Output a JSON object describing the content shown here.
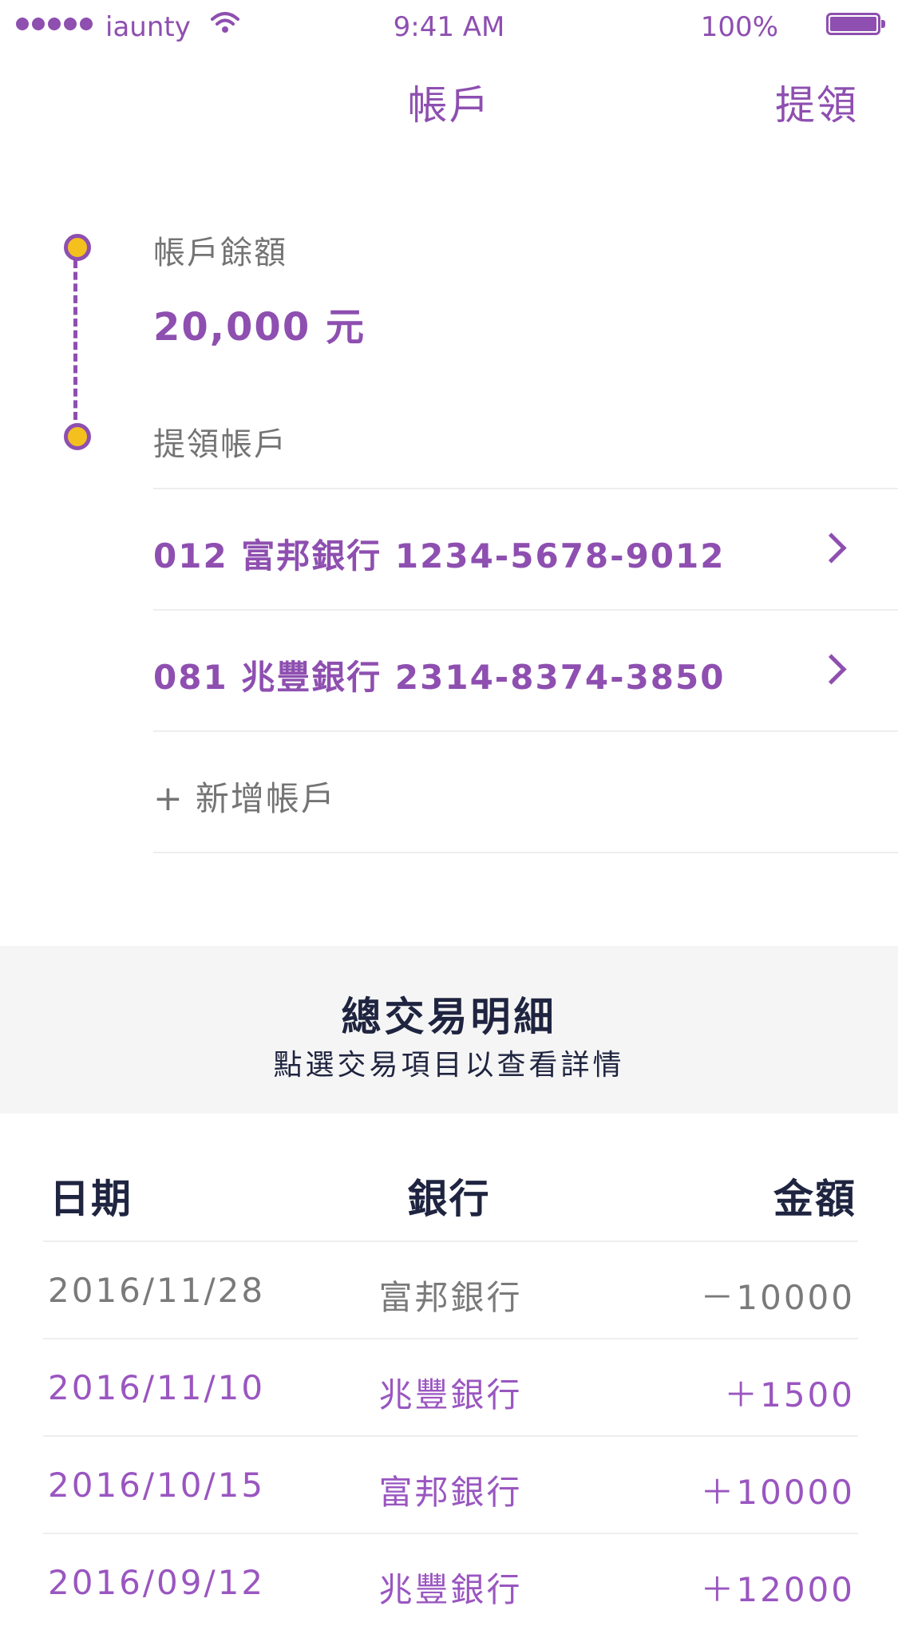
{
  "status_bar": {
    "carrier": "iaunty",
    "time": "9:41 AM",
    "battery": "100%"
  },
  "nav": {
    "title": "帳戶",
    "right_action": "提領"
  },
  "balance": {
    "label": "帳戶餘額",
    "value": "20,000 元"
  },
  "withdraw": {
    "label": "提領帳戶",
    "accounts": [
      {
        "label": "012 富邦銀行 1234-5678-9012"
      },
      {
        "label": "081 兆豐銀行 2314-8374-3850"
      }
    ],
    "add_label": "新增帳戶"
  },
  "summary": {
    "title": "總交易明細",
    "subtitle": "點選交易項目以查看詳情"
  },
  "table": {
    "headers": {
      "date": "日期",
      "bank": "銀行",
      "amount": "金額"
    },
    "rows": [
      {
        "date": "2016/11/28",
        "bank": "富邦銀行",
        "amount": "－10000"
      },
      {
        "date": "2016/11/10",
        "bank": "兆豐銀行",
        "amount": "＋1500"
      },
      {
        "date": "2016/10/15",
        "bank": "富邦銀行",
        "amount": "＋10000"
      },
      {
        "date": "2016/09/12",
        "bank": "兆豐銀行",
        "amount": "＋12000"
      }
    ]
  },
  "colors": {
    "accent": "#8e4fb0",
    "dot": "#f4c01e",
    "dark_text": "#1f2440",
    "gray_text": "#747474",
    "band_bg": "#f5f5f5"
  }
}
